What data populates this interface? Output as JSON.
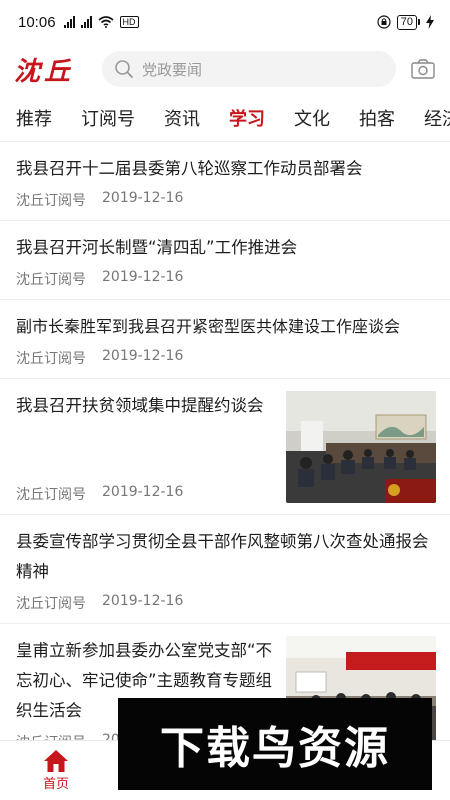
{
  "status_bar": {
    "time": "10:06",
    "network_badge": "HD",
    "battery": "70"
  },
  "header": {
    "logo_text": "沈丘",
    "search_placeholder": "党政要闻",
    "camera_icon": "camera-icon",
    "brand_color": "#c8161d"
  },
  "tabs": [
    {
      "label": "推荐",
      "active": false
    },
    {
      "label": "订阅号",
      "active": false
    },
    {
      "label": "资讯",
      "active": false
    },
    {
      "label": "学习",
      "active": true
    },
    {
      "label": "文化",
      "active": false
    },
    {
      "label": "拍客",
      "active": false
    },
    {
      "label": "经济",
      "active": false
    }
  ],
  "feed": [
    {
      "title": "我县召开十二届县委第八轮巡察工作动员部署会",
      "source": "沈丘订阅号",
      "date": "2019-12-16"
    },
    {
      "title": "我县召开河长制暨“清四乱”工作推进会",
      "source": "沈丘订阅号",
      "date": "2019-12-16"
    },
    {
      "title": "副市长秦胜军到我县召开紧密型医共体建设工作座谈会",
      "source": "沈丘订阅号",
      "date": "2019-12-16"
    },
    {
      "title": "我县召开扶贫领域集中提醒约谈会",
      "source": "沈丘订阅号",
      "date": "2019-12-16",
      "has_image": true
    },
    {
      "title": "县委宣传部学习贯彻全县干部作风整顿第八次查处通报会精神",
      "source": "沈丘订阅号",
      "date": "2019-12-16"
    },
    {
      "title": "皇甫立新参加县委办公室党支部“不忘初心、牢记使命”主题教育专题组织生活会",
      "source": "沈丘订阅号",
      "date": "2019-12-16",
      "has_image": true
    }
  ],
  "bottom_nav": {
    "home_label": "首页"
  },
  "watermark": {
    "text": "下载鸟资源"
  }
}
